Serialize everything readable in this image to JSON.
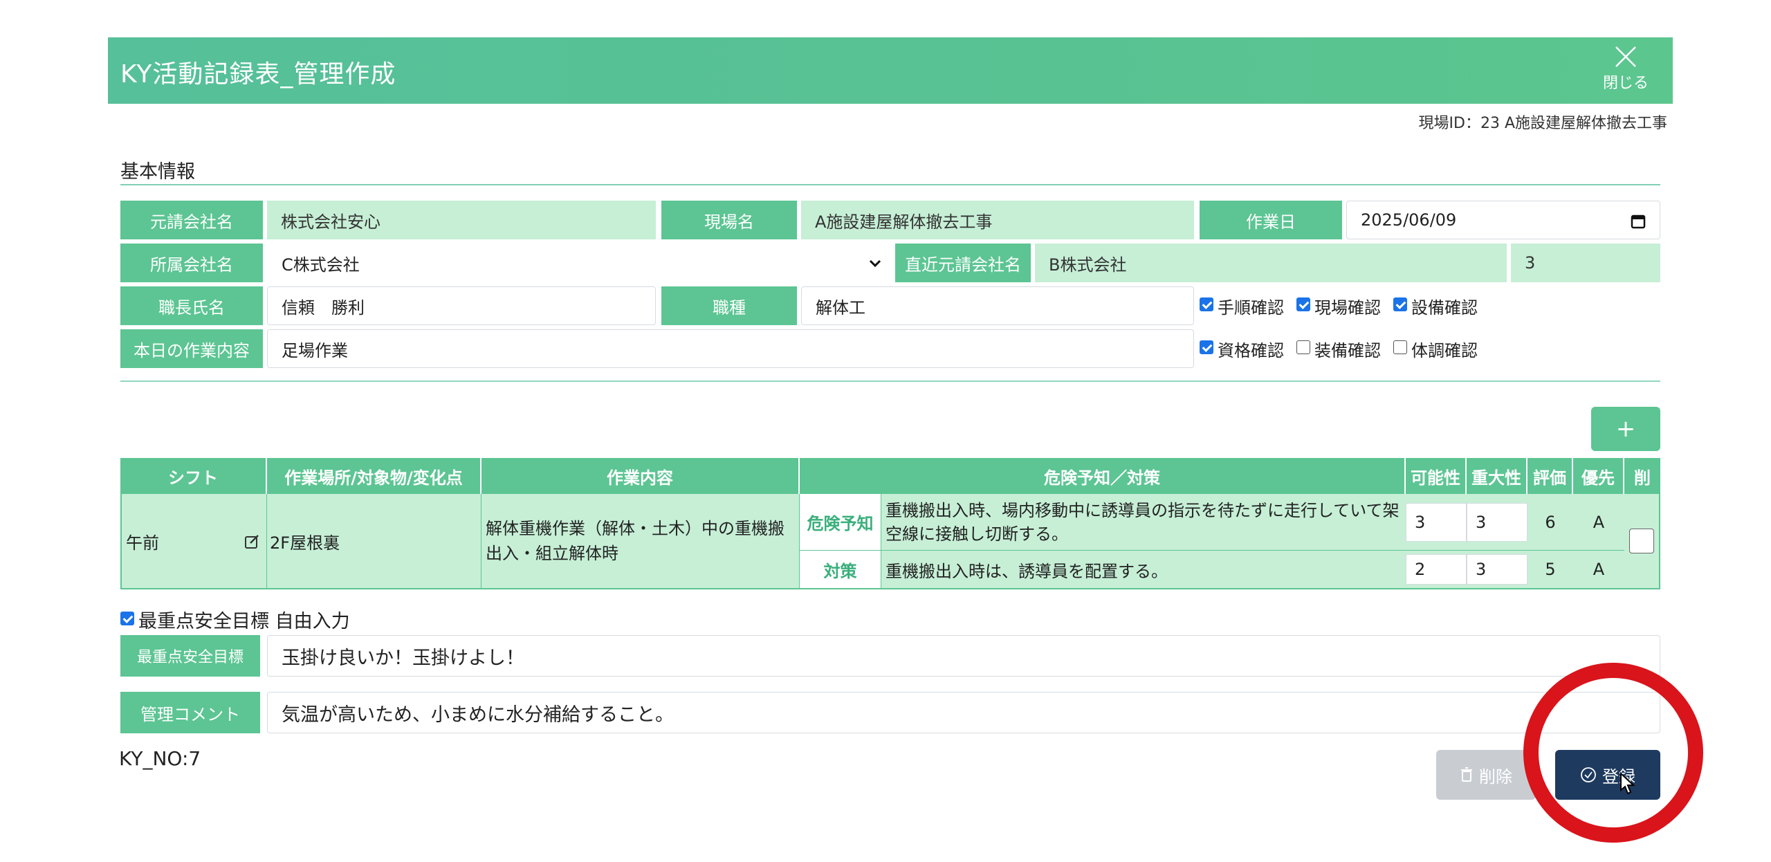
{
  "header": {
    "title": "KY活動記録表_管理作成",
    "close_label": "閉じる"
  },
  "site_id": "現場ID：23 A施設建屋解体撤去工事",
  "basic_info": {
    "section_title": "基本情報",
    "prime_contractor_label": "元請会社名",
    "prime_contractor_value": "株式会社安心",
    "site_name_label": "現場名",
    "site_name_value": "A施設建屋解体撤去工事",
    "work_date_label": "作業日",
    "work_date_value": "2025/06/09",
    "affiliated_company_label": "所属会社名",
    "affiliated_company_value": "C株式会社",
    "direct_prime_label": "直近元請会社名",
    "direct_prime_value": "B株式会社",
    "direct_prime_number": "3",
    "foreman_label": "職長氏名",
    "foreman_value": "信頼　勝利",
    "trade_label": "職種",
    "trade_value": "解体工",
    "todays_work_label": "本日の作業内容",
    "todays_work_value": "足場作業",
    "checks_row1": [
      {
        "label": "手順確認",
        "checked": true
      },
      {
        "label": "現場確認",
        "checked": true
      },
      {
        "label": "設備確認",
        "checked": true
      }
    ],
    "checks_row2": [
      {
        "label": "資格確認",
        "checked": true
      },
      {
        "label": "装備確認",
        "checked": false
      },
      {
        "label": "体調確認",
        "checked": false
      }
    ]
  },
  "add_button": "+",
  "table": {
    "headers": {
      "shift": "シフト",
      "place": "作業場所/対象物/変化点",
      "content": "作業内容",
      "hazard": "危険予知／対策",
      "possibility": "可能性",
      "severity": "重大性",
      "evaluation": "評価",
      "priority": "優先",
      "delete": "削"
    },
    "row": {
      "shift": "午前",
      "place": "2F屋根裏",
      "content": "解体重機作業（解体・土木）中の重機搬出入・組立解体時",
      "hazard_label": "危険予知",
      "hazard_text": "重機搬出入時、場内移動中に誘導員の指示を待たずに走行していて架空線に接触し切断する。",
      "hazard_possibility": "3",
      "hazard_severity": "3",
      "hazard_evaluation": "6",
      "hazard_priority": "A",
      "measure_label": "対策",
      "measure_text": "重機搬出入時は、誘導員を配置する。",
      "measure_possibility": "2",
      "measure_severity": "3",
      "measure_evaluation": "5",
      "measure_priority": "A"
    }
  },
  "free_input": {
    "label": "最重点安全目標 自由入力",
    "checked": true
  },
  "safety_goal": {
    "label": "最重点安全目標",
    "value": "玉掛け良いか！玉掛けよし！"
  },
  "management_comment": {
    "label": "管理コメント",
    "value": "気温が高いため、小まめに水分補給すること。"
  },
  "ky_no": "KY_NO:7",
  "buttons": {
    "delete": "削除",
    "register": "登録"
  },
  "colors": {
    "accent": "#5cc593",
    "light": "#c6efd6",
    "primary_button": "#1e3a5f",
    "highlight": "#d9141b"
  }
}
